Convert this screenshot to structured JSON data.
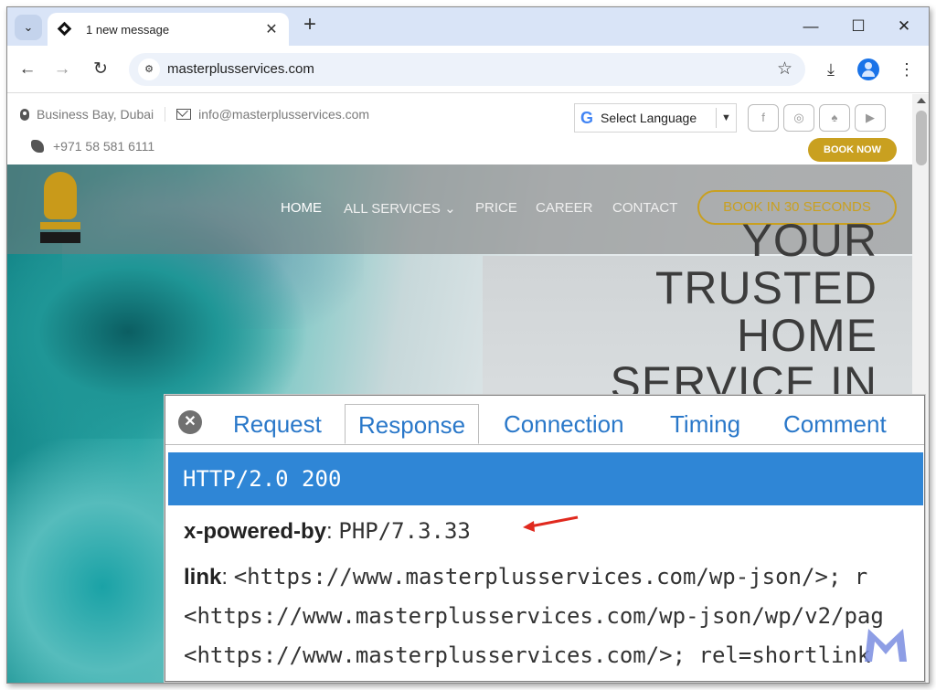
{
  "browser": {
    "tab_title": "1 new message",
    "url": "masterplusservices.com"
  },
  "site": {
    "location": "Business Bay, Dubai",
    "email": "info@masterplusservices.com",
    "phone": "+971 58 581 6111",
    "translate_label": "Select Language",
    "book_now": "BOOK NOW",
    "social": [
      "f",
      "ig",
      "sc",
      "yt"
    ],
    "nav": {
      "home": "HOME",
      "services": "ALL SERVICES",
      "services_caret": "⌄",
      "price": "PRICE",
      "career": "CAREER",
      "contact": "CONTACT"
    },
    "book_cta": "BOOK IN 30 SECONDS",
    "headline": [
      "YOUR",
      "TRUSTED",
      "HOME",
      "SERVICE IN"
    ],
    "accent_color": "#c9a020"
  },
  "devtools": {
    "tabs": [
      "Request",
      "Response",
      "Connection",
      "Timing",
      "Comment"
    ],
    "selected_tab": "Response",
    "status": "HTTP/2.0 200",
    "headers": {
      "powered_name": "x-powered-by",
      "powered_value": "PHP/7.3.33",
      "link_name": "link",
      "link_line1": "<https://www.masterplusservices.com/wp-json/>; r",
      "link_line2": "<https://www.masterplusservices.com/wp-json/wp/v2/pag",
      "link_line3": "<https://www.masterplusservices.com/>; rel=shortlink"
    },
    "status_color": "#2f86d6",
    "arrow_color": "#e0291e"
  }
}
